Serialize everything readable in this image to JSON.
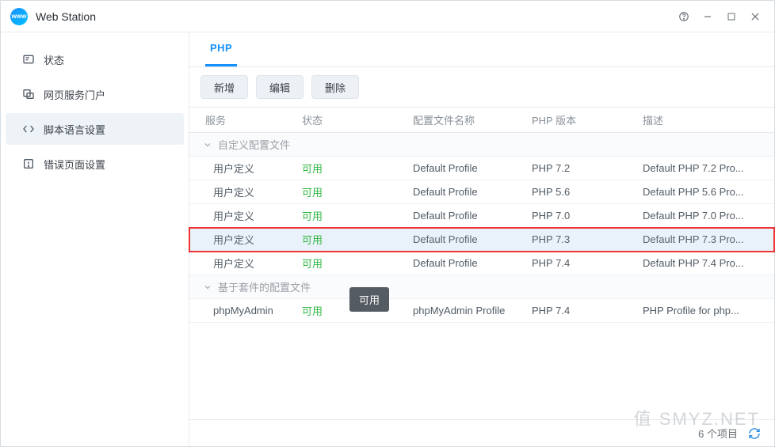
{
  "app": {
    "title": "Web Station",
    "logo_text": "www"
  },
  "sidebar": {
    "items": [
      {
        "icon": "status-icon",
        "label": "状态"
      },
      {
        "icon": "portal-icon",
        "label": "网页服务门户"
      },
      {
        "icon": "script-icon",
        "label": "脚本语言设置"
      },
      {
        "icon": "error-icon",
        "label": "错误页面设置"
      }
    ]
  },
  "tabs": {
    "active": "PHP"
  },
  "toolbar": {
    "new_label": "新增",
    "edit_label": "编辑",
    "delete_label": "删除"
  },
  "columns": {
    "service": "服务",
    "status": "状态",
    "profile": "配置文件名称",
    "version": "PHP 版本",
    "desc": "描述"
  },
  "groups": [
    {
      "title": "自定义配置文件",
      "rows": [
        {
          "service": "用户定义",
          "status": "可用",
          "profile": "Default Profile",
          "version": "PHP 7.2",
          "desc": "Default PHP 7.2 Pro..."
        },
        {
          "service": "用户定义",
          "status": "可用",
          "profile": "Default Profile",
          "version": "PHP 5.6",
          "desc": "Default PHP 5.6 Pro..."
        },
        {
          "service": "用户定义",
          "status": "可用",
          "profile": "Default Profile",
          "version": "PHP 7.0",
          "desc": "Default PHP 7.0 Pro..."
        },
        {
          "service": "用户定义",
          "status": "可用",
          "profile": "Default Profile",
          "version": "PHP 7.3",
          "desc": "Default PHP 7.3 Pro...",
          "selected": true
        },
        {
          "service": "用户定义",
          "status": "可用",
          "profile": "Default Profile",
          "version": "PHP 7.4",
          "desc": "Default PHP 7.4 Pro..."
        }
      ]
    },
    {
      "title": "基于套件的配置文件",
      "rows": [
        {
          "service": "phpMyAdmin",
          "status": "可用",
          "profile": "phpMyAdmin Profile",
          "version": "PHP 7.4",
          "desc": "PHP Profile for php..."
        }
      ]
    }
  ],
  "tooltip": "可用",
  "footer": {
    "count_text": "6 个项目"
  },
  "watermark": "值 SMYZ.NET"
}
